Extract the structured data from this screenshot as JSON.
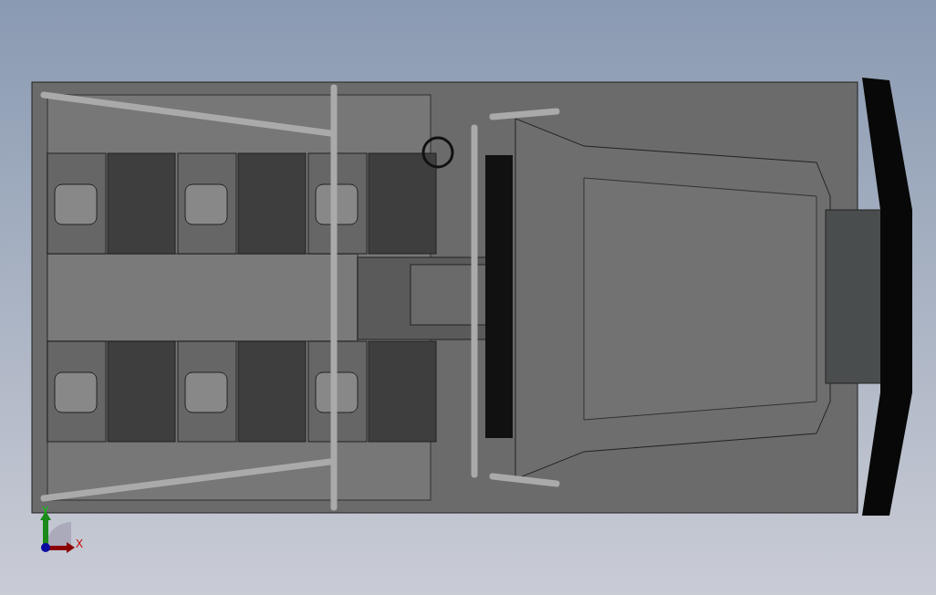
{
  "viewport": {
    "model": {
      "kind": "vehicle"
    },
    "triad": {
      "x_label": "X",
      "y_label": "Y"
    }
  }
}
